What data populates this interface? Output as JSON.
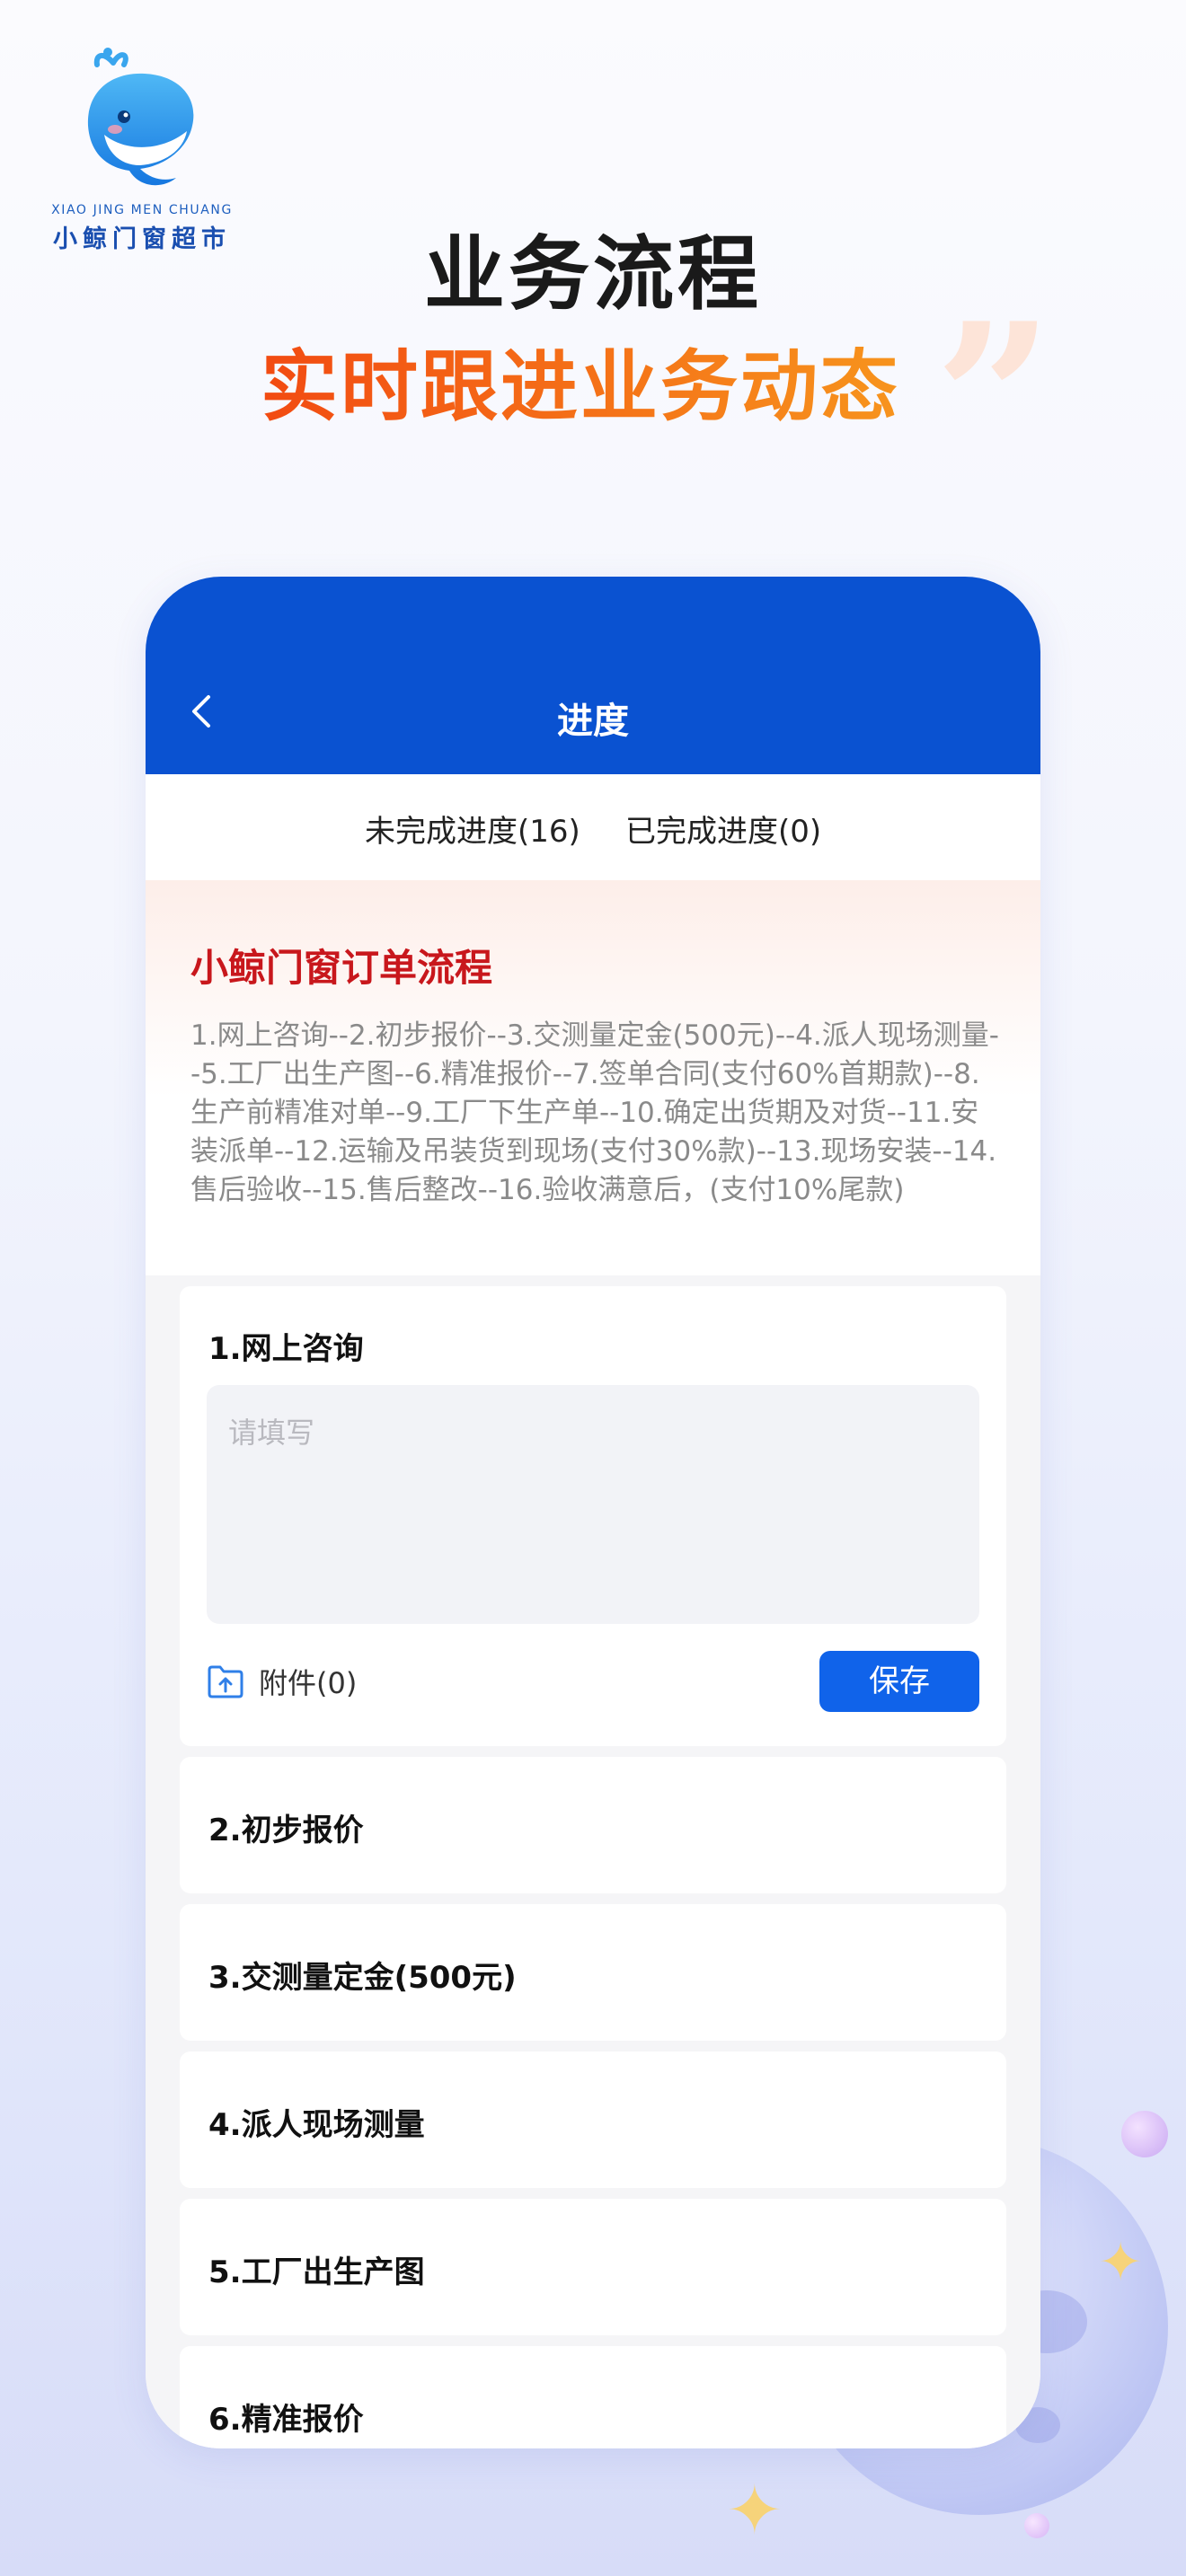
{
  "brand": {
    "name_en": "XIAO JING MEN CHUANG",
    "name_cn": "小鲸门窗超市"
  },
  "hero": {
    "title": "业务流程",
    "subtitle": "实时跟进业务动态"
  },
  "colors": {
    "header_blue": "#0a52d1",
    "accent_red": "#c8171c",
    "gradient_orange_start": "#f24b12",
    "gradient_orange_end": "#f7941d",
    "button_blue": "#1063ea"
  },
  "screen": {
    "title": "进度",
    "back_icon": "chevron-left-icon",
    "tabs": [
      {
        "label": "未完成进度(16)"
      },
      {
        "label": "已完成进度(0)"
      }
    ],
    "intro": {
      "title": "小鲸门窗订单流程",
      "text": "1.网上咨询--2.初步报价--3.交测量定金(500元)--4.派人现场测量--5.工厂出生产图--6.精准报价--7.签单合同(支付60%首期款)--8.生产前精准对单--9.工厂下生产单--10.确定出货期及对货--11.安装派单--12.运输及吊装货到现场(支付30%款)--13.现场安装--14.售后验收--15.售后整改--16.验收满意后，(支付10%尾款)"
    },
    "steps": [
      {
        "title": "1.网上咨询",
        "placeholder": "请填写",
        "attachment_label": "附件(0)",
        "attachment_icon": "folder-upload-icon",
        "save_label": "保存"
      },
      {
        "title": "2.初步报价"
      },
      {
        "title": "3.交测量定金(500元)"
      },
      {
        "title": "4.派人现场测量"
      },
      {
        "title": "5.工厂出生产图"
      },
      {
        "title": "6.精准报价"
      }
    ]
  }
}
